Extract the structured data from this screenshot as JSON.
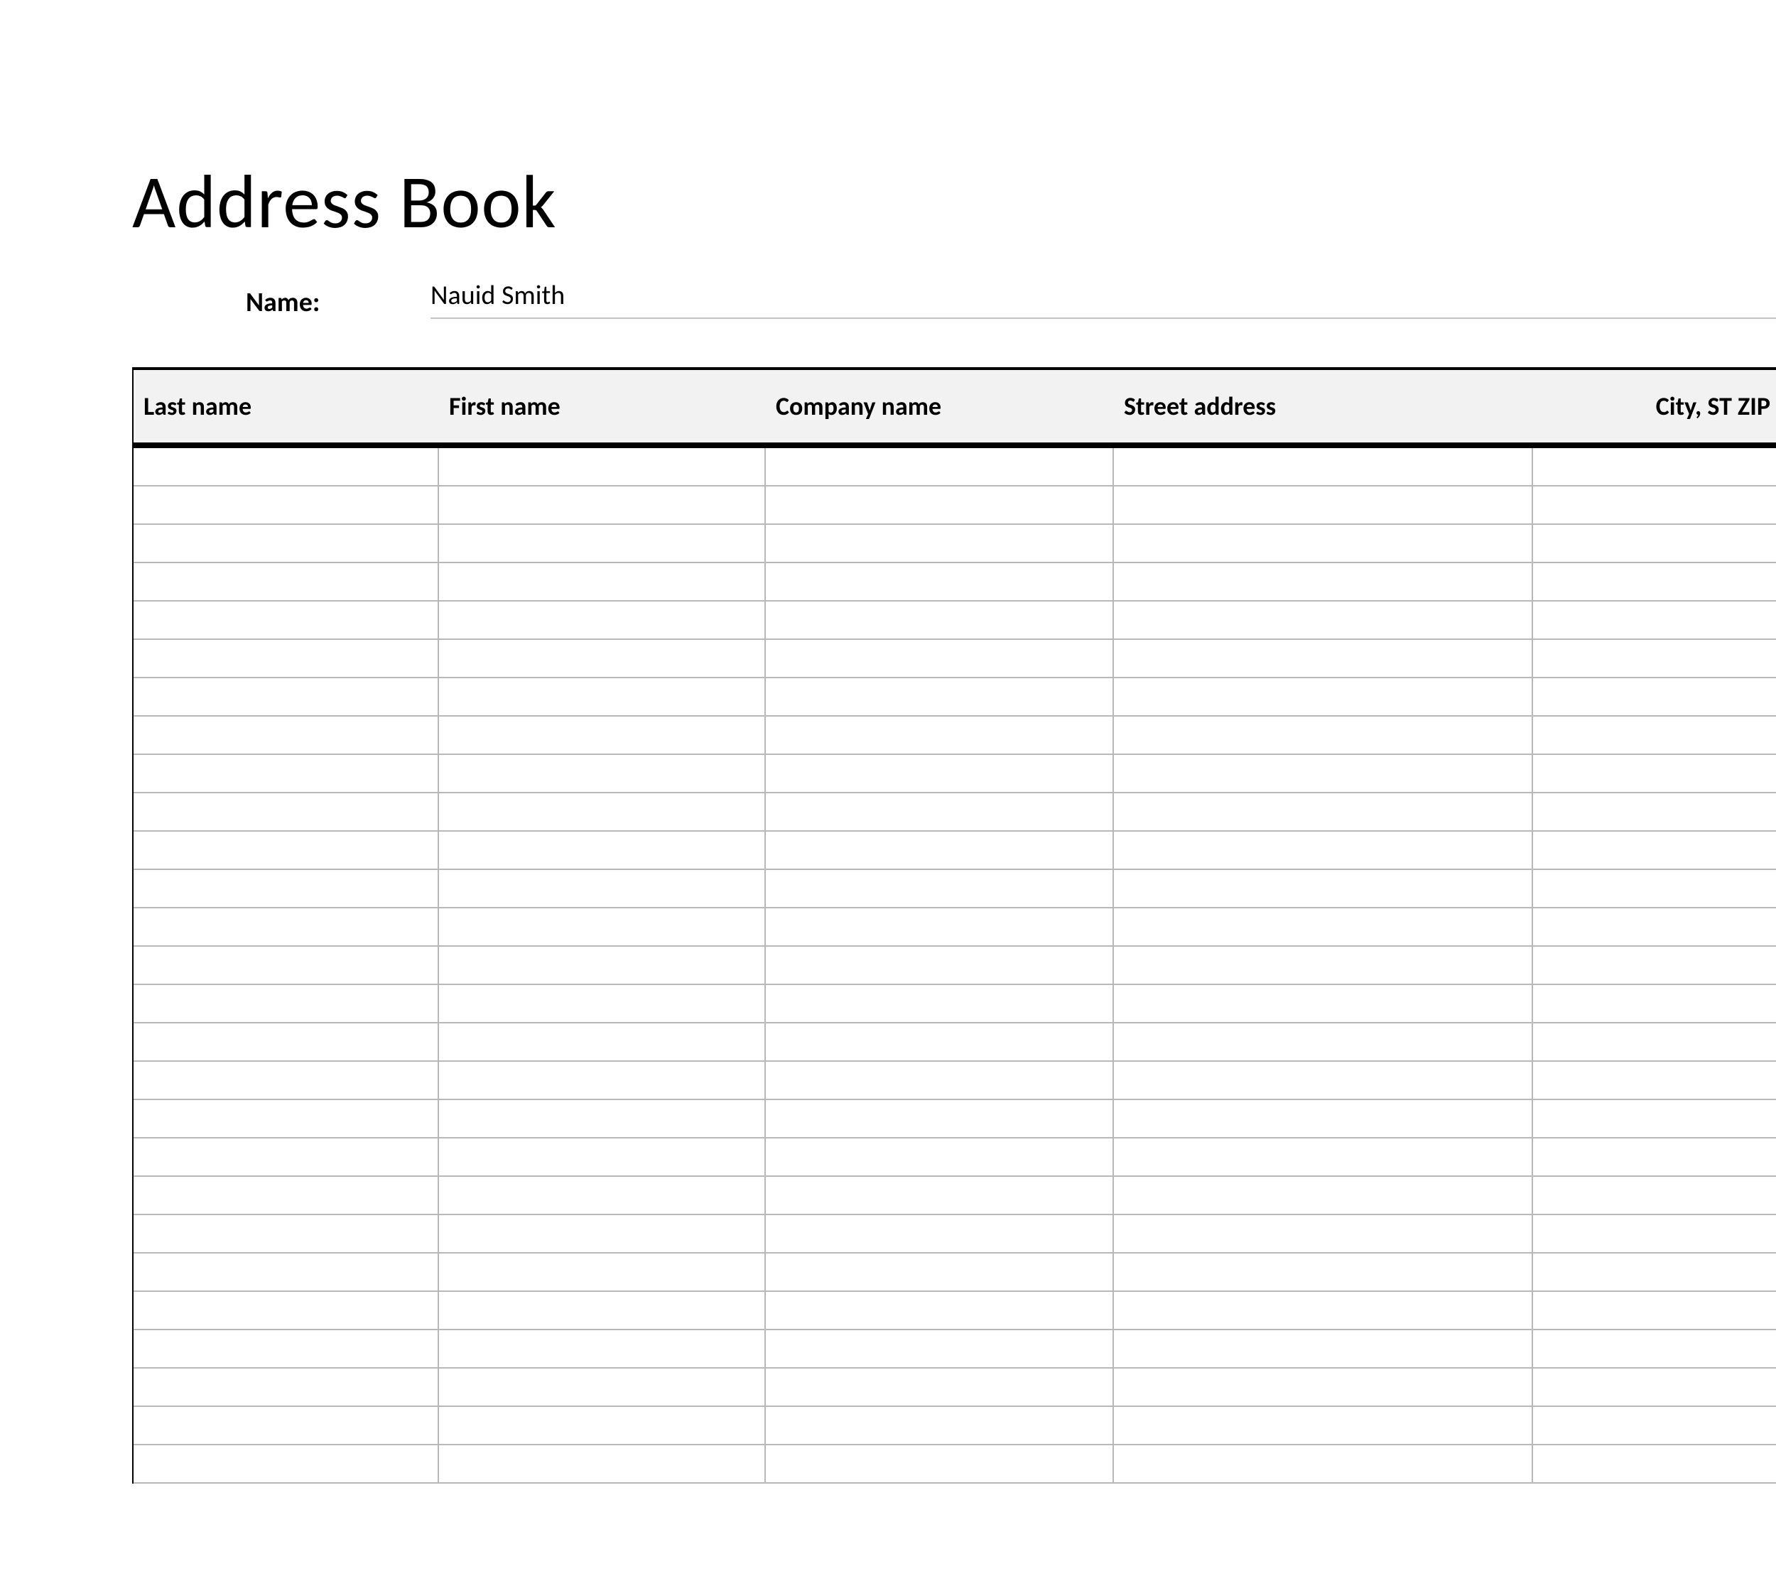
{
  "title": "Address Book",
  "name_field": {
    "label": "Name:",
    "value": "Nauid Smith"
  },
  "table": {
    "columns": [
      {
        "key": "last_name",
        "label": "Last name"
      },
      {
        "key": "first_name",
        "label": "First name"
      },
      {
        "key": "company_name",
        "label": "Company name"
      },
      {
        "key": "street_address",
        "label": "Street address"
      },
      {
        "key": "city_st_zip",
        "label": "City, ST  ZIP"
      }
    ],
    "row_count": 27
  }
}
